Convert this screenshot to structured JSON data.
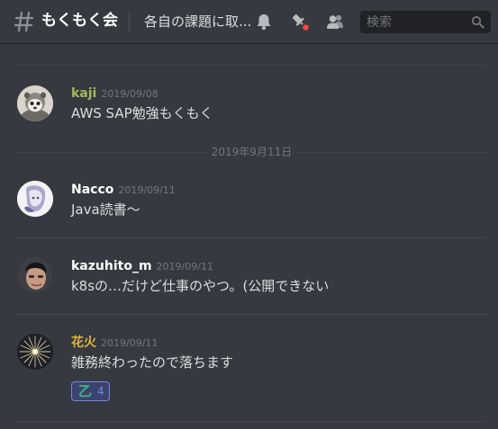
{
  "header": {
    "channel_name": "もくもく会",
    "topic": "各自の課題に取...",
    "search_placeholder": "検索"
  },
  "icons": {
    "channel": "hash-icon",
    "notifications": "bell-icon",
    "pinned": "pin-icon",
    "members": "members-icon",
    "search": "search-icon"
  },
  "colors": {
    "background": "#36393f",
    "kaji_name": "#a5b85a",
    "default_name": "#ffffff",
    "hanabi_name": "#e0b63f",
    "reaction_accent": "#7289da",
    "notification_dot": "#f04747"
  },
  "messages": [
    {
      "author": "kaji",
      "timestamp": "2019/09/08",
      "text": "AWS SAP勉強もくもく"
    },
    {
      "author": "Nacco",
      "timestamp": "2019/09/11",
      "text": "Java読書〜"
    },
    {
      "author": "kazuhito_m",
      "timestamp": "2019/09/11",
      "text": "k8sの…だけど仕事のやつ。(公開できない"
    },
    {
      "author": "花火",
      "timestamp": "2019/09/11",
      "text": "雑務終わったので落ちます",
      "reaction": {
        "emoji": "乙",
        "count": "4"
      }
    }
  ],
  "date_divider": "2019年9月11日"
}
